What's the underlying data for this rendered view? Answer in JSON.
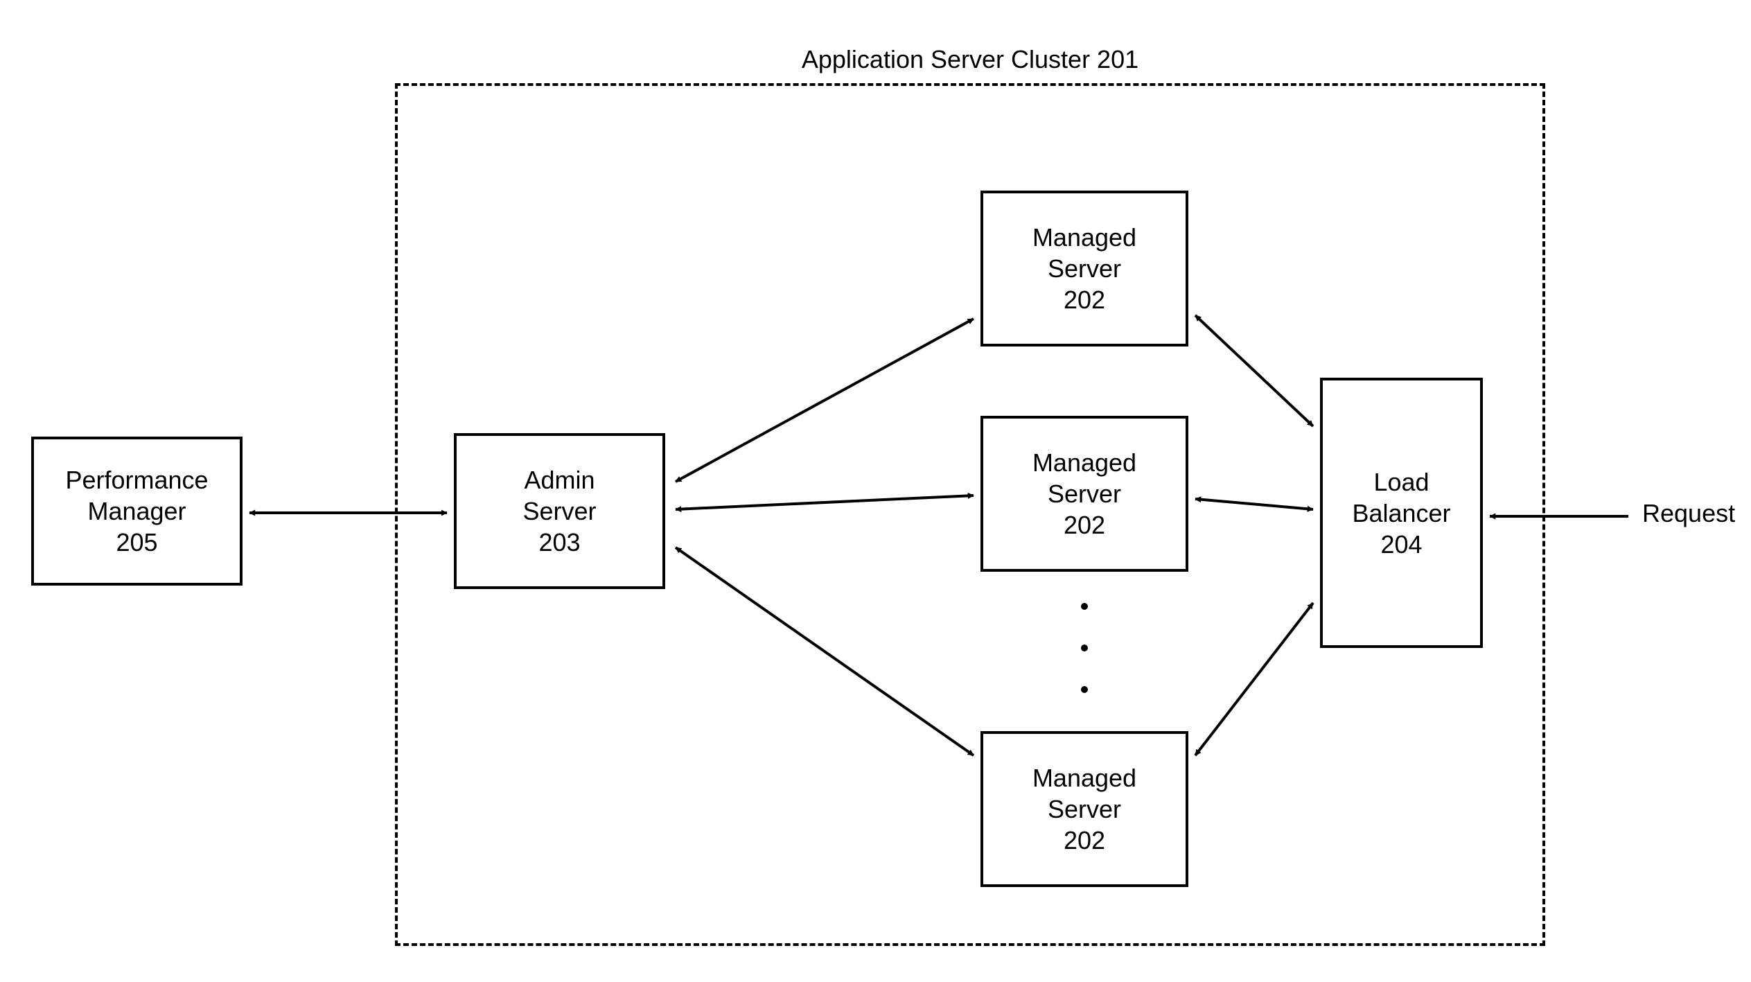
{
  "cluster": {
    "title": "Application Server Cluster 201"
  },
  "nodes": {
    "performance_manager": {
      "label": "Performance\nManager\n205"
    },
    "admin_server": {
      "label": "Admin\nServer\n203"
    },
    "managed_server_1": {
      "label": "Managed\nServer\n202"
    },
    "managed_server_2": {
      "label": "Managed\nServer\n202"
    },
    "managed_server_3": {
      "label": "Managed\nServer\n202"
    },
    "load_balancer": {
      "label": "Load\nBalancer\n204"
    }
  },
  "external": {
    "request_label": "Request"
  }
}
